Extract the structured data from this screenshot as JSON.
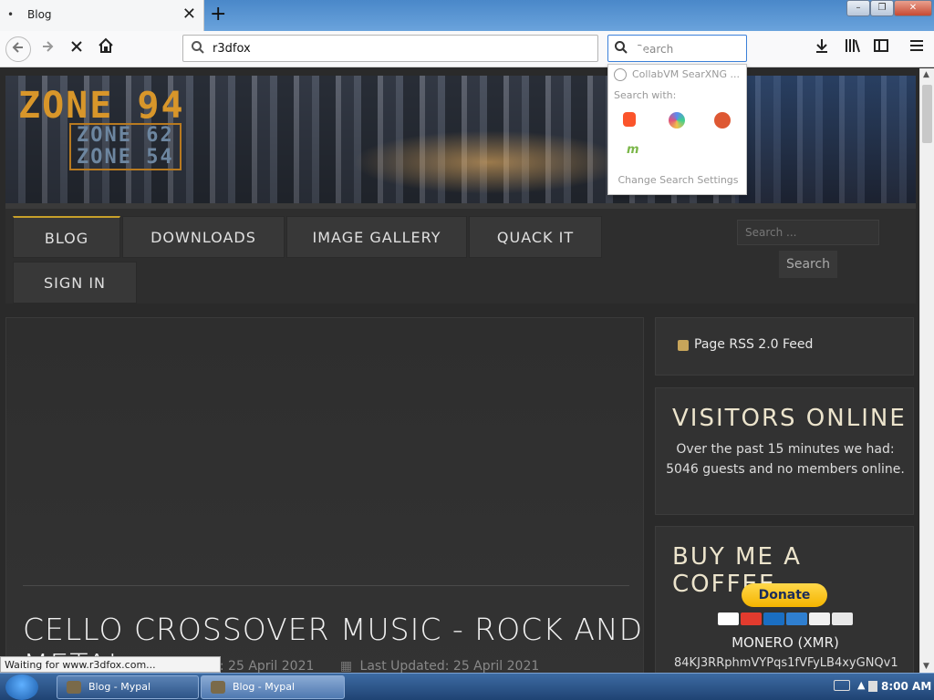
{
  "browser": {
    "tab_title": "Blog",
    "tab_dot": "•",
    "close_glyph": "✕",
    "newtab_glyph": "+",
    "url": "r3dfox",
    "search_placeholder": "Search",
    "window_min": "–",
    "window_max": "❐",
    "window_close": "✕"
  },
  "search_popup": {
    "default_engine": "CollabVM SearXNG ...",
    "search_with_label": "Search with:",
    "mojeek_glyph": "m",
    "change_settings": "Change Search Settings"
  },
  "site": {
    "logo_main": "ZONE 94",
    "logo_sub1": "ZONE 62",
    "logo_sub2": "ZONE 54",
    "menu": {
      "blog": "BLOG",
      "downloads": "DOWNLOADS",
      "gallery": "IMAGE GALLERY",
      "quack": "QUACK IT",
      "signin": "SIGN IN"
    },
    "search_placeholder": "Search ...",
    "search_button": "Search",
    "post_title": "CELLO CROSSOVER MUSIC - ROCK AND METAL",
    "post_date_fragment": "d: 25 April 2021",
    "post_updated": "Last Updated: 25 April 2021",
    "sidebar": {
      "rss_label": "Page RSS 2.0 Feed",
      "visitors_title": "VISITORS ONLINE",
      "visitors_text": "Over the past 15 minutes we had: 5046 guests and no members online.",
      "coffee_title": "BUY ME A COFFEE",
      "donate_label": "Donate",
      "monero_label": "MONERO (XMR)",
      "monero_address": "84KJ3RRphmVYPqs1fVFyLB4xyGNQv1"
    }
  },
  "status_text": "Waiting for www.r3dfox.com...",
  "taskbar": {
    "button1": "Blog - Mypal",
    "button2": "Blog - Mypal",
    "tray_arrow": "▲",
    "clock": "8:00 AM"
  },
  "colors": {
    "accent_gold": "#c8a02a",
    "page_bg": "#2a2a2a",
    "focus_blue": "#3c80d9"
  }
}
